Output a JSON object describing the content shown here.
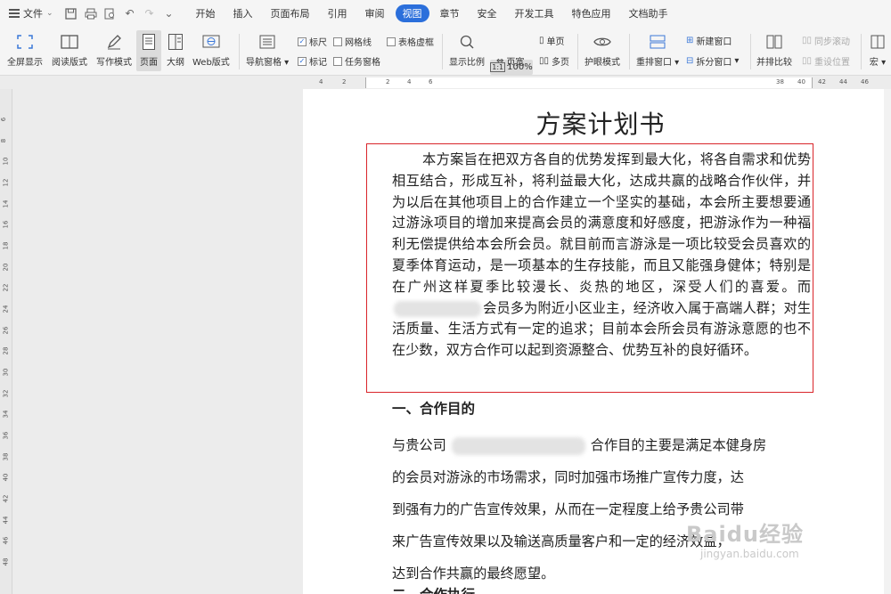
{
  "menu": {
    "file_label": "文件",
    "tabs": [
      "开始",
      "插入",
      "页面布局",
      "引用",
      "审阅",
      "视图",
      "章节",
      "安全",
      "开发工具",
      "特色应用",
      "文档助手"
    ],
    "active_tab": "视图"
  },
  "ribbon": {
    "fullscreen": "全屏显示",
    "reading": "阅读版式",
    "writing": "写作模式",
    "page": "页面",
    "outline": "大纲",
    "web": "Web版式",
    "nav_pane": "导航窗格",
    "ruler": "标尺",
    "gridlines": "网格线",
    "table_lines": "表格虚框",
    "marks": "标记",
    "task_pane": "任务窗格",
    "zoom_ratio": "显示比例",
    "zoom_value": "100%",
    "single_page": "单页",
    "page_width": "页宽",
    "multi_page": "多页",
    "eye_mode": "护眼模式",
    "rearrange": "重排窗口",
    "new_window": "新建窗口",
    "split_window": "拆分窗口",
    "side_by_side": "并排比较",
    "sync_scroll": "同步滚动",
    "reset_pos": "重设位置",
    "macro": "宏"
  },
  "ruler": {
    "h_numbers": [
      "4",
      "2",
      "2",
      "4",
      "6",
      "38",
      "40",
      "42",
      "44",
      "46"
    ],
    "v_numbers": [
      "6",
      "8",
      "10",
      "12",
      "14",
      "16",
      "18",
      "20",
      "22",
      "24",
      "26",
      "28",
      "30",
      "32",
      "34",
      "36",
      "38",
      "40",
      "42",
      "44",
      "46",
      "48"
    ]
  },
  "document": {
    "title": "方案计划书",
    "intro": "本方案旨在把双方各自的优势发挥到最大化，将各自需求和优势相互结合，形成互补，将利益最大化，达成共赢的战略合作伙伴，并为以后在其他项目上的合作建立一个坚实的基础，本会所主要想要通过游泳项目的增加来提高会员的满意度和好感度，把游泳作为一种福利无偿提供给本会所会员。就目前而言游泳是一项比较受会员喜欢的夏季体育运动，是一项基本的生存技能，而且又能强身健体；特别是在广州这样夏季比较漫长、炎热的地区，深受人们的喜爱。而",
    "intro_tail": "会员多为附近小区业主，经济收入属于高端人群；对生活质量、生活方式有一定的追求；目前本会所会员有游泳意愿的也不在少数，双方合作可以起到资源整合、优势互补的良好循环。",
    "heading1": "一、合作目的",
    "body_lines": [
      "与贵公司",
      "合作目的主要是满足本健身房",
      "的会员对游泳的市场需求，同时加强市场推广宣传力度，达",
      "到强有力的广告宣传效果，从而在一定程度上给予贵公司带",
      "来广告宣传效果以及输送高质量客户和一定的经济效益，",
      "达到合作共赢的最终愿望。"
    ],
    "heading2": "二、合作执行"
  },
  "watermark": {
    "brand": "Baidu经验",
    "url": "jingyan.baidu.com"
  }
}
